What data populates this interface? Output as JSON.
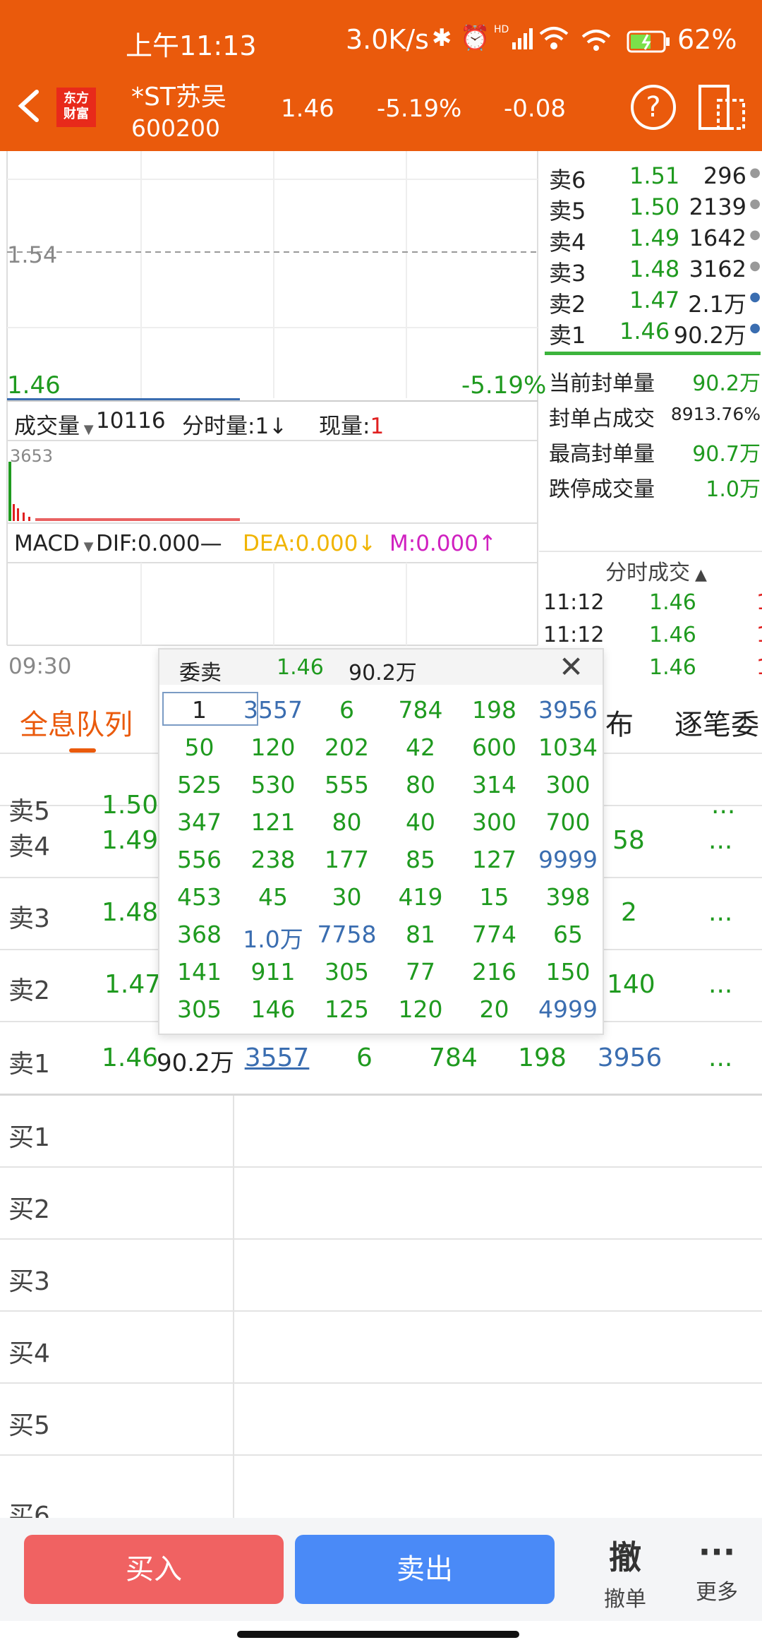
{
  "status": {
    "time": "上午11:13",
    "speed": "3.0K/s",
    "battery": "62%"
  },
  "header": {
    "logo": "东方\n财富",
    "name": "*ST苏吴",
    "code": "600200",
    "price": "1.46",
    "pct": "-5.19%",
    "chg": "-0.08"
  },
  "chart": {
    "ref_price": "1.54",
    "cur_price": "1.46",
    "cur_pct": "-5.19%",
    "start_time": "09:30",
    "vol_bar": {
      "sel": "成交量",
      "total": "10116",
      "fenshi_label": "分时量:",
      "fenshi_val": "1↓",
      "xian_label": "现量:",
      "xian_val": "1"
    },
    "vol_max": "3653",
    "macd": {
      "sel": "MACD",
      "dif": "DIF:0.000—",
      "dea": "DEA:0.000↓",
      "m": "M:0.000↑"
    }
  },
  "orderbook": {
    "asks": [
      {
        "label": "卖6",
        "price": "1.51",
        "vol": "296"
      },
      {
        "label": "卖5",
        "price": "1.50",
        "vol": "2139"
      },
      {
        "label": "卖4",
        "price": "1.49",
        "vol": "1642"
      },
      {
        "label": "卖3",
        "price": "1.48",
        "vol": "3162"
      },
      {
        "label": "卖2",
        "price": "1.47",
        "vol": "2.1万"
      },
      {
        "label": "卖1",
        "price": "1.46",
        "vol": "90.2万"
      }
    ],
    "stats": [
      {
        "label": "当前封单量",
        "value": "90.2万"
      },
      {
        "label": "封单占成交",
        "value": "8913.76%"
      },
      {
        "label": "最高封单量",
        "value": "90.7万"
      },
      {
        "label": "跌停成交量",
        "value": "1.0万"
      }
    ],
    "ticks_title": "分时成交",
    "ticks": [
      {
        "time": "11:12",
        "price": "1.46",
        "vol": "1"
      },
      {
        "time": "11:12",
        "price": "1.46",
        "vol": "1"
      },
      {
        "time": "",
        "price": "1.46",
        "vol": "1"
      }
    ]
  },
  "tabs": {
    "t1": "全息队列",
    "t2": "布",
    "t3": "逐笔委"
  },
  "queue": {
    "rows": [
      {
        "label": "卖4",
        "price": "1.49",
        "extra": "58",
        "more": "..."
      },
      {
        "label": "卖3",
        "price": "1.48",
        "extra": "2",
        "more": "..."
      },
      {
        "label": "卖2",
        "price": "1.47",
        "extra": "140",
        "more": "..."
      }
    ],
    "s1": {
      "label": "卖1",
      "price": "1.46",
      "vol": "90.2万",
      "items": [
        "3557",
        "6",
        "784",
        "198",
        "3956"
      ],
      "more": "..."
    },
    "buys": [
      "买1",
      "买2",
      "买3",
      "买4",
      "买5",
      "买6"
    ]
  },
  "popup": {
    "title": "委卖",
    "price": "1.46",
    "vol": "90.2万",
    "grid": [
      [
        "1",
        "3557",
        "6",
        "784",
        "198",
        "3956"
      ],
      [
        "50",
        "120",
        "202",
        "42",
        "600",
        "1034"
      ],
      [
        "525",
        "530",
        "555",
        "80",
        "314",
        "300"
      ],
      [
        "347",
        "121",
        "80",
        "40",
        "300",
        "700"
      ],
      [
        "556",
        "238",
        "177",
        "85",
        "127",
        "9999"
      ],
      [
        "453",
        "45",
        "30",
        "419",
        "15",
        "398"
      ],
      [
        "368",
        "1.0万",
        "7758",
        "81",
        "774",
        "65"
      ],
      [
        "141",
        "911",
        "305",
        "77",
        "216",
        "150"
      ],
      [
        "305",
        "146",
        "125",
        "120",
        "20",
        "4999"
      ]
    ],
    "blue": [
      "0-1",
      "0-5",
      "4-5",
      "6-1",
      "6-2",
      "8-5"
    ]
  },
  "bottom": {
    "buy": "买入",
    "sell": "卖出",
    "cancel_icon": "撤",
    "cancel": "撤单",
    "more": "更多"
  }
}
